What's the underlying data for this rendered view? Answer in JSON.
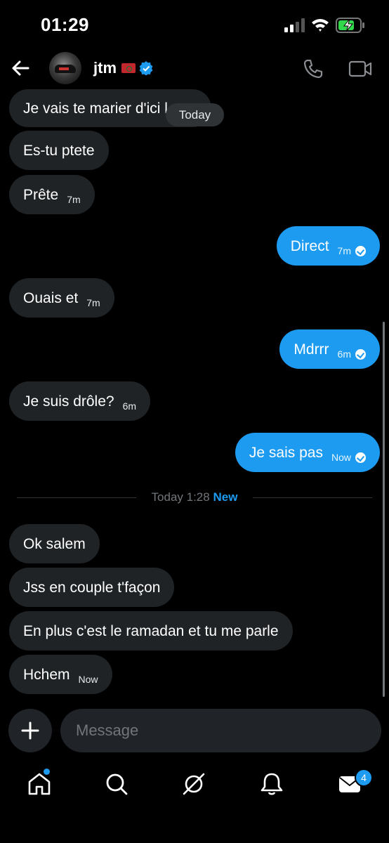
{
  "status_bar": {
    "time": "01:29"
  },
  "header": {
    "username": "jtm"
  },
  "date_pill": "Today",
  "messages": [
    {
      "dir": "in",
      "text": "Je vais te marier d'ici l",
      "time": ""
    },
    {
      "dir": "in",
      "text": "Es-tu ptete",
      "time": ""
    },
    {
      "dir": "in",
      "text": "Prête",
      "time": "7m"
    },
    {
      "dir": "out",
      "text": "Direct",
      "time": "7m"
    },
    {
      "dir": "in",
      "text": "Ouais et",
      "time": "7m"
    },
    {
      "dir": "out",
      "text": "Mdrrr",
      "time": "6m"
    },
    {
      "dir": "in",
      "text": "Je suis drôle?",
      "time": "6m"
    },
    {
      "dir": "out",
      "text": "Je sais pas",
      "time": "Now"
    },
    {
      "dir": "in",
      "text": "Ok salem",
      "time": ""
    },
    {
      "dir": "in",
      "text": "Jss en couple t'façon",
      "time": ""
    },
    {
      "dir": "in",
      "text": "En plus c'est le ramadan et tu me parle",
      "time": ""
    },
    {
      "dir": "in",
      "text": "Hchem",
      "time": "Now"
    }
  ],
  "divider": {
    "label": "Today 1:28",
    "new_label": "New"
  },
  "composer": {
    "placeholder": "Message"
  },
  "nav": {
    "items": [
      "home-icon",
      "search-icon",
      "grok-icon",
      "notifications-icon",
      "messages-icon"
    ],
    "messages_badge": "4"
  },
  "colors": {
    "accent": "#1d9bf0",
    "incoming_bubble": "#1f2326",
    "background": "#000000"
  }
}
